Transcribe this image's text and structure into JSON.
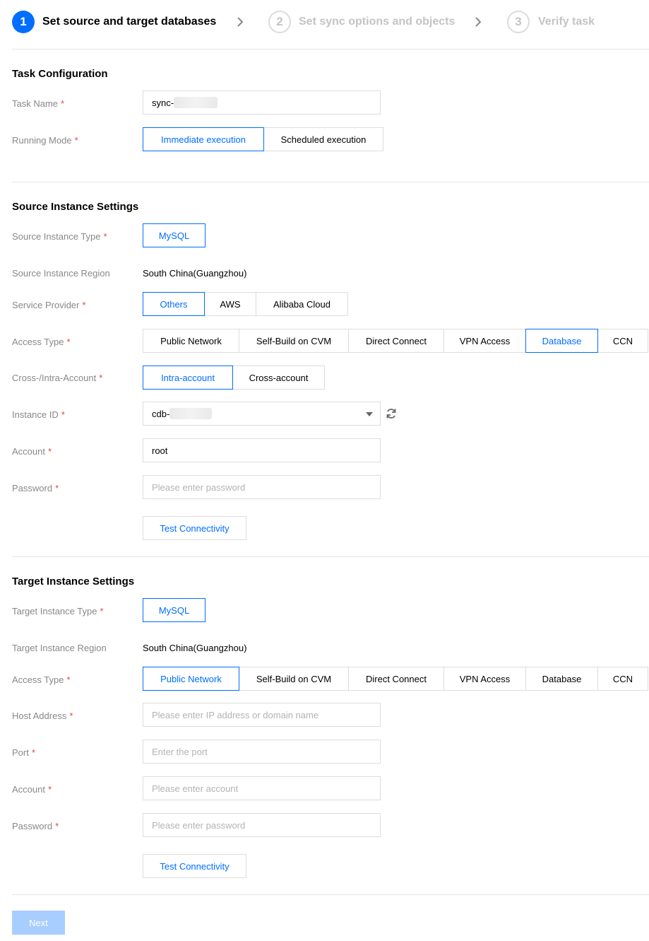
{
  "steps": [
    {
      "number": "1",
      "label": "Set source and target databases",
      "state": "active"
    },
    {
      "number": "2",
      "label": "Set sync options and objects",
      "state": "inactive"
    },
    {
      "number": "3",
      "label": "Verify task",
      "state": "inactive"
    }
  ],
  "task": {
    "title": "Task Configuration",
    "task_name_label": "Task Name",
    "task_name_value": "sync-",
    "running_mode_label": "Running Mode",
    "running_mode_options": [
      "Immediate execution",
      "Scheduled execution"
    ],
    "running_mode_selected": "Immediate execution"
  },
  "source": {
    "title": "Source Instance Settings",
    "type_label": "Source Instance Type",
    "type_value": "MySQL",
    "region_label": "Source Instance Region",
    "region_value": "South China(Guangzhou)",
    "provider_label": "Service Provider",
    "provider_options": [
      "Others",
      "AWS",
      "Alibaba Cloud"
    ],
    "provider_selected": "Others",
    "access_label": "Access Type",
    "access_options": [
      "Public Network",
      "Self-Build on CVM",
      "Direct Connect",
      "VPN Access",
      "Database",
      "CCN"
    ],
    "access_selected": "Database",
    "account_scope_label": "Cross-/Intra-Account",
    "account_scope_options": [
      "Intra-account",
      "Cross-account"
    ],
    "account_scope_selected": "Intra-account",
    "instance_id_label": "Instance ID",
    "instance_id_value": "cdb-",
    "account_label": "Account",
    "account_value": "root",
    "password_label": "Password",
    "password_placeholder": "Please enter password",
    "test_button": "Test Connectivity"
  },
  "target": {
    "title": "Target Instance Settings",
    "type_label": "Target Instance Type",
    "type_value": "MySQL",
    "region_label": "Target Instance Region",
    "region_value": "South China(Guangzhou)",
    "access_label": "Access Type",
    "access_options": [
      "Public Network",
      "Self-Build on CVM",
      "Direct Connect",
      "VPN Access",
      "Database",
      "CCN"
    ],
    "access_selected": "Public Network",
    "host_label": "Host Address",
    "host_placeholder": "Please enter IP address or domain name",
    "port_label": "Port",
    "port_placeholder": "Enter the port",
    "account_label": "Account",
    "account_placeholder": "Please enter account",
    "password_label": "Password",
    "password_placeholder": "Please enter password",
    "test_button": "Test Connectivity"
  },
  "footer": {
    "next_label": "Next"
  },
  "required_mark": "*",
  "colors": {
    "accent": "#006eff",
    "required": "#e54545",
    "label": "#888888",
    "disabled_button": "#a8cdff"
  }
}
